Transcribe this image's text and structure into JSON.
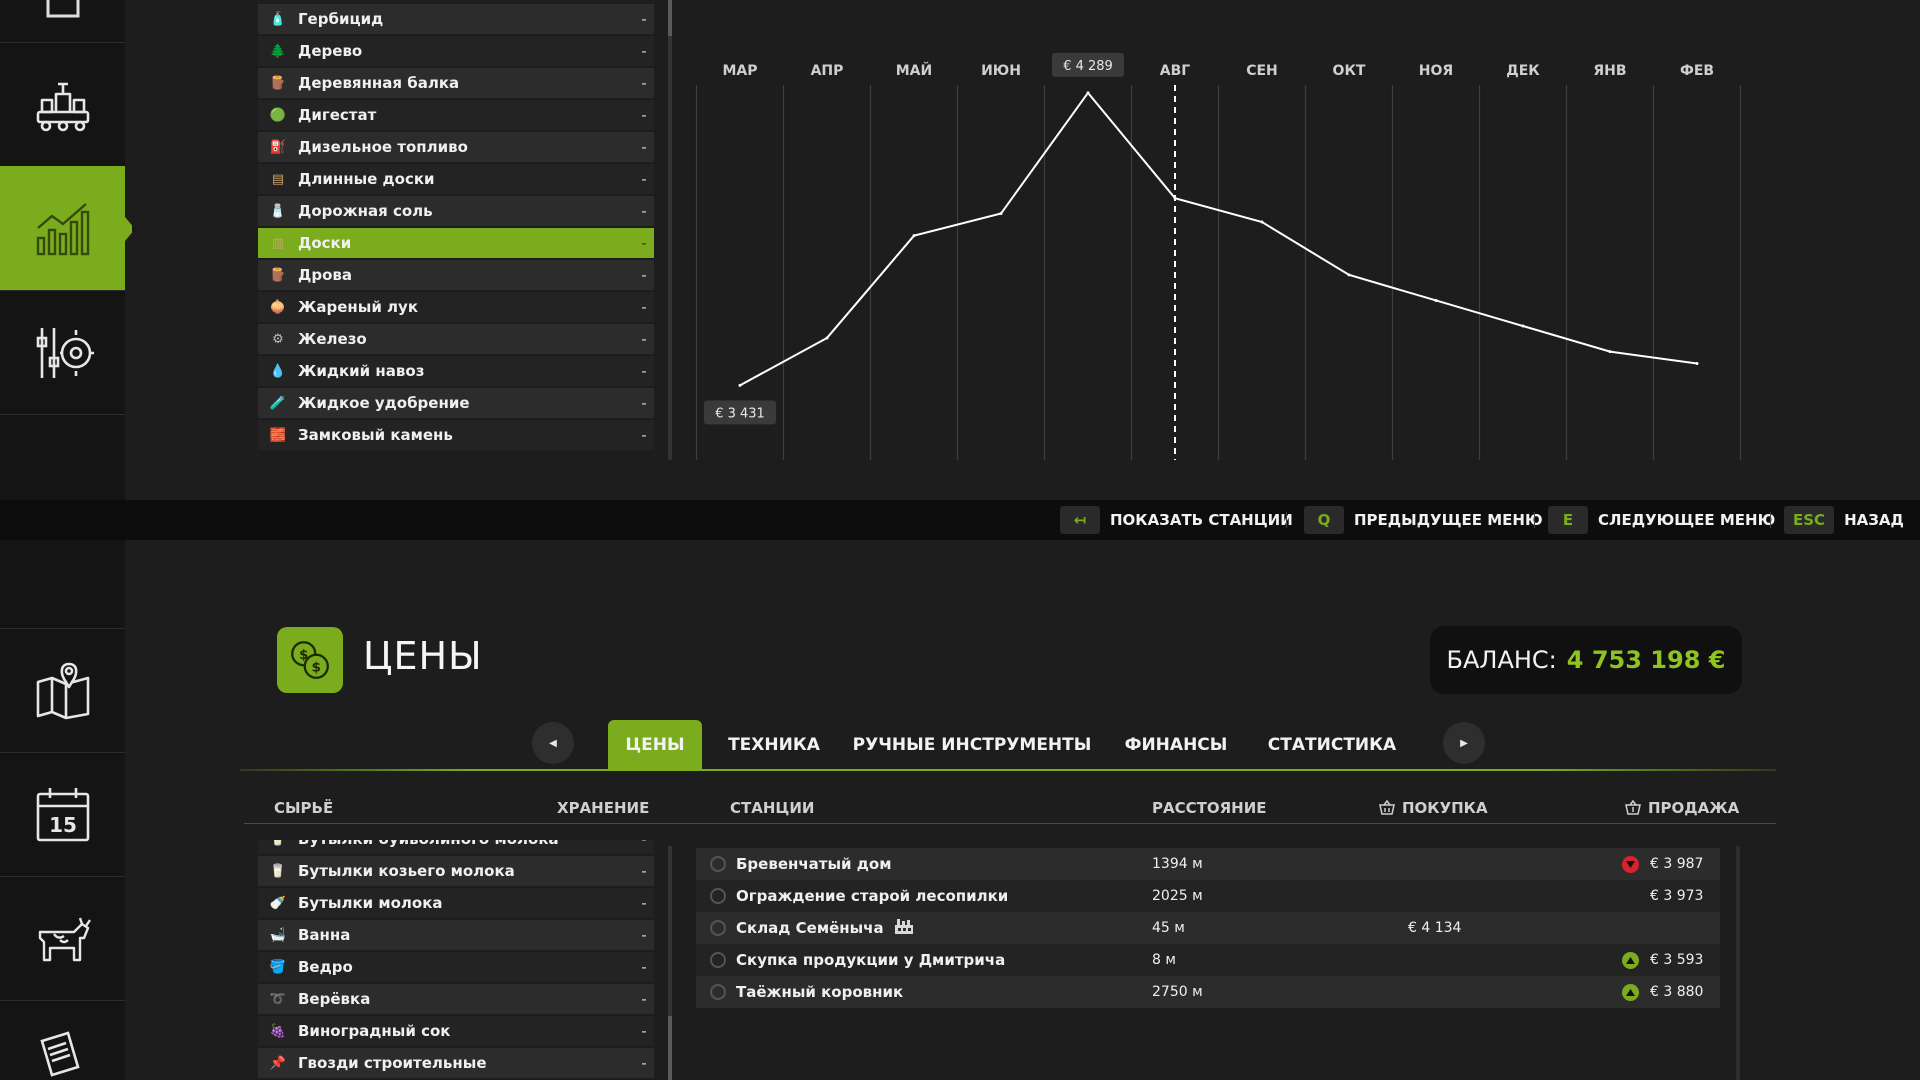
{
  "top_list": {
    "items": [
      {
        "label": "Гербицид",
        "value": "-",
        "icon": "herbicide-icon"
      },
      {
        "label": "Дерево",
        "value": "-",
        "icon": "tree-icon"
      },
      {
        "label": "Деревянная балка",
        "value": "-",
        "icon": "wooden-beam-icon"
      },
      {
        "label": "Дигестат",
        "value": "-",
        "icon": "digestate-icon"
      },
      {
        "label": "Дизельное топливо",
        "value": "-",
        "icon": "diesel-icon"
      },
      {
        "label": "Длинные доски",
        "value": "-",
        "icon": "long-planks-icon"
      },
      {
        "label": "Дорожная соль",
        "value": "-",
        "icon": "road-salt-icon"
      },
      {
        "label": "Доски",
        "value": "-",
        "icon": "planks-icon"
      },
      {
        "label": "Дрова",
        "value": "-",
        "icon": "firewood-icon"
      },
      {
        "label": "Жареный лук",
        "value": "-",
        "icon": "fried-onion-icon"
      },
      {
        "label": "Железо",
        "value": "-",
        "icon": "iron-icon"
      },
      {
        "label": "Жидкий навоз",
        "value": "-",
        "icon": "liquid-manure-icon"
      },
      {
        "label": "Жидкое удобрение",
        "value": "-",
        "icon": "liquid-fertilizer-icon"
      },
      {
        "label": "Замковый камень",
        "value": "-",
        "icon": "keystone-icon"
      }
    ],
    "selected_index": 7
  },
  "chart_data": {
    "type": "line",
    "categories": [
      "МАР",
      "АПР",
      "МАЙ",
      "ИЮН",
      "ИЮЛ",
      "АВГ",
      "СЕН",
      "ОКТ",
      "НОЯ",
      "ДЕК",
      "ЯНВ",
      "ФЕВ"
    ],
    "series": [
      {
        "values": [
          3431,
          3570,
          3870,
          3935,
          4289,
          3980,
          3910,
          3755,
          3680,
          3605,
          3530,
          3495
        ]
      }
    ],
    "current_month_index": 5,
    "ylim": [
      3300,
      4400
    ],
    "annotations": {
      "max_label": "€ 4 289",
      "min_label": "€ 3 431"
    },
    "grid": true,
    "line_color": "#ffffff"
  },
  "action_bar": {
    "items": [
      {
        "key": "↤",
        "label": "ПОКАЗАТЬ СТАНЦИИ"
      },
      {
        "key": "Q",
        "label": "ПРЕДЫДУЩЕЕ МЕНЮ"
      },
      {
        "key": "E",
        "label": "СЛЕДУЮЩЕЕ МЕНЮ"
      },
      {
        "key": "ESC",
        "label": "НАЗАД"
      }
    ]
  },
  "header": {
    "title": "ЦЕНЫ",
    "icon": "coins-icon",
    "balance_label": "БАЛАНС:",
    "balance_value": "4 753 198 €"
  },
  "tabs": {
    "items": [
      "ЦЕНЫ",
      "ТЕХНИКА",
      "РУЧНЫЕ ИНСТРУМЕНТЫ",
      "ФИНАНСЫ",
      "СТАТИСТИКА"
    ],
    "active_index": 0
  },
  "table_headers": {
    "goods": "СЫРЬЁ",
    "storage": "ХРАНЕНИЕ",
    "stations": "СТАНЦИИ",
    "distance": "РАССТОЯНИЕ",
    "buy": "ПОКУПКА",
    "sell": "ПРОДАЖА"
  },
  "bottom_list": {
    "partial_top_label": "Бутылки буйволиного молока",
    "items": [
      {
        "label": "Бутылки козьего молока",
        "value": "-",
        "icon": "goat-milk-bottle-icon"
      },
      {
        "label": "Бутылки молока",
        "value": "-",
        "icon": "milk-bottle-icon"
      },
      {
        "label": "Ванна",
        "value": "-",
        "icon": "bathtub-icon"
      },
      {
        "label": "Ведро",
        "value": "-",
        "icon": "bucket-icon"
      },
      {
        "label": "Верёвка",
        "value": "-",
        "icon": "rope-icon"
      },
      {
        "label": "Виноградный сок",
        "value": "-",
        "icon": "grape-juice-icon"
      },
      {
        "label": "Гвозди строительные",
        "value": "-",
        "icon": "nails-icon"
      }
    ]
  },
  "stations": [
    {
      "name": "Бревенчатый дом",
      "distance": "1394 м",
      "buy": "",
      "sell": "€ 3 987",
      "trend": "down",
      "extra_icon": ""
    },
    {
      "name": "Ограждение старой лесопилки",
      "distance": "2025 м",
      "buy": "",
      "sell": "€ 3 973",
      "trend": "",
      "extra_icon": ""
    },
    {
      "name": "Склад Семёныча",
      "distance": "45 м",
      "buy": "€ 4 134",
      "sell": "",
      "trend": "",
      "extra_icon": "factory-icon"
    },
    {
      "name": "Скупка продукции у Дмитрича",
      "distance": "8 м",
      "buy": "",
      "sell": "€ 3 593",
      "trend": "up",
      "extra_icon": ""
    },
    {
      "name": "Таёжный коровник",
      "distance": "2750 м",
      "buy": "",
      "sell": "€ 3 880",
      "trend": "up",
      "extra_icon": ""
    }
  ],
  "colors": {
    "accent": "#7aac1d",
    "balance": "#8fc31f",
    "trend_down": "#d8232a",
    "trend_up": "#7aac1d"
  }
}
